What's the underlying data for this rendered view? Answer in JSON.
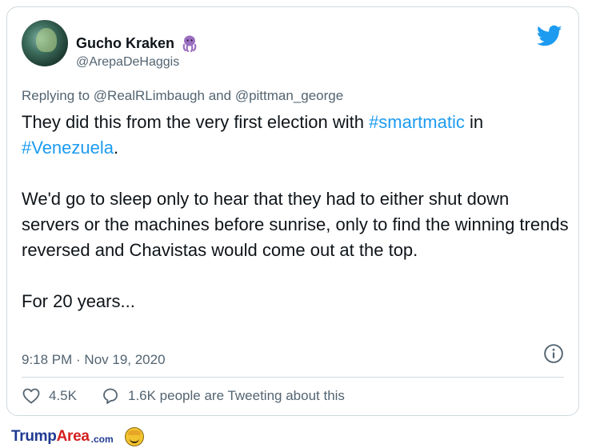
{
  "tweet": {
    "display_name": "Gucho Kraken",
    "name_emoji": "octopus-icon",
    "handle": "@ArepaDeHaggis",
    "replying_prefix": "Replying to",
    "reply_mention_1": "@RealRLimbaugh",
    "reply_and": "and",
    "reply_mention_2": "@pittman_george",
    "p1_a": "They did this from the very first election with ",
    "p1_hashtag_1": "#smartmatic",
    "p1_b": " in",
    "p1_hashtag_2": "#Venezuela",
    "p1_c": ".",
    "p2": "We'd go to sleep only to hear that they had to either shut down servers or the machines before sunrise, only to find the winning trends reversed and Chavistas would come out at the top.",
    "p3": "For 20 years...",
    "timestamp": "9:18 PM · Nov 19, 2020",
    "like_count": "4.5K",
    "tweeting_text": "1.6K people are Tweeting about this"
  },
  "colors": {
    "accent": "#1d9bf0",
    "octopus": "#9b6fc0",
    "brand_blue": "#1f3a93",
    "brand_red": "#d42020"
  },
  "watermark": {
    "brand_part_1": "Trump",
    "brand_part_2": "Area",
    "brand_tld": ".com"
  }
}
